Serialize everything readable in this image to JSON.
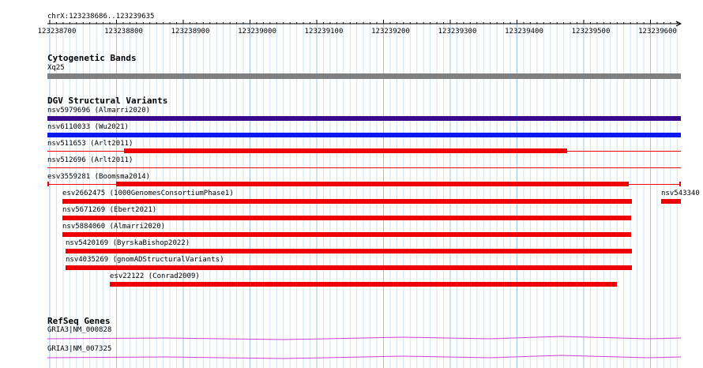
{
  "ruler": {
    "location": "chrX:123238686..123239635",
    "ticks": [
      "123238700",
      "123238800",
      "123238900",
      "123239000",
      "123239100",
      "123239200",
      "123239300",
      "123239400",
      "123239500",
      "123239600"
    ]
  },
  "cytoband": {
    "title": "Cytogenetic Bands",
    "band": "Xq25",
    "color": "#808080"
  },
  "dgv": {
    "title": "DGV Structural Variants",
    "variants": [
      {
        "label": "nsv5979696 (Almarri2020)",
        "color": "#3a0a8c"
      },
      {
        "label": "nsv6110033 (Wu2021)",
        "color": "#0a1aef"
      },
      {
        "label": "nsv511653 (Arlt2011)",
        "color": "#ef0000"
      },
      {
        "label": "nsv512696 (Arlt2011)",
        "color": "#ef0000"
      },
      {
        "label": "esv3559281 (Boomsma2014)",
        "color": "#ef0000"
      },
      {
        "label": "esv2662475 (1000GenomesConsortiumPhase1)",
        "color": "#ef0000"
      },
      {
        "label": "nsv543340",
        "color": "#ef0000"
      },
      {
        "label": "nsv5671269 (Ebert2021)",
        "color": "#ef0000"
      },
      {
        "label": "nsv5884060 (Almarri2020)",
        "color": "#ef0000"
      },
      {
        "label": "nsv5420169 (ByrskaBishop2022)",
        "color": "#ef0000"
      },
      {
        "label": "nsv4035269 (gnomADStructuralVariants)",
        "color": "#ef0000"
      },
      {
        "label": "esv22122 (Conrad2009)",
        "color": "#ef0000"
      }
    ]
  },
  "refseq": {
    "title": "RefSeq Genes",
    "genes": [
      {
        "label": "GRIA3|NM_000828",
        "color": "#d040d0"
      },
      {
        "label": "GRIA3|NM_007325",
        "color": "#d040d0"
      }
    ]
  }
}
